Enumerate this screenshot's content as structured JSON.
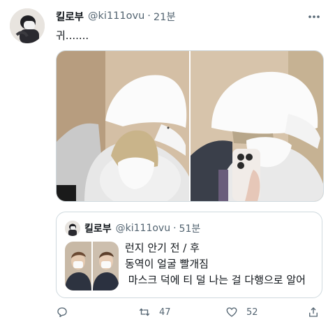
{
  "tweet": {
    "author_name": "킬로부",
    "author_handle": "@ki111ovu",
    "separator": "·",
    "timestamp": "21분",
    "text": "귀......."
  },
  "quote": {
    "author_name": "킬로부",
    "author_handle": "@ki111ovu",
    "separator": "·",
    "timestamp": "51분",
    "lines": [
      "런지 안기 전 / 후",
      "동역이 얼굴 빨개짐",
      " 마스크 덕에 티 덜 나는 걸 다행으로 알어"
    ]
  },
  "actions": {
    "reply": {
      "icon": "reply-icon",
      "count": ""
    },
    "retweet": {
      "icon": "retweet-icon",
      "count": "47"
    },
    "like": {
      "icon": "heart-icon",
      "count": "52"
    },
    "share": {
      "icon": "share-icon",
      "count": ""
    }
  },
  "colors": {
    "text_primary": "#0f1419",
    "text_secondary": "#536471",
    "border": "#cfd9de"
  }
}
